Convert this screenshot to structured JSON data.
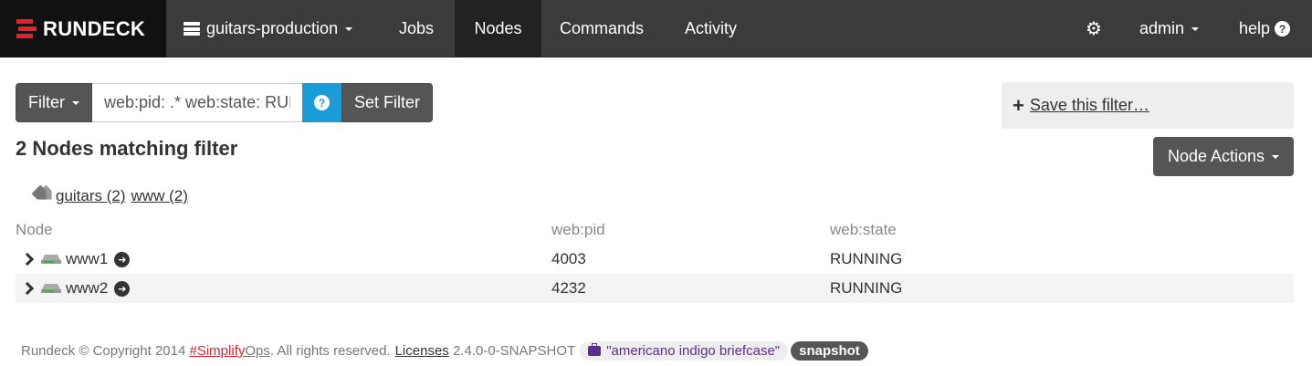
{
  "navbar": {
    "brand": "RUNDECK",
    "project": "guitars-production",
    "items": [
      {
        "label": "Jobs"
      },
      {
        "label": "Nodes"
      },
      {
        "label": "Commands"
      },
      {
        "label": "Activity"
      }
    ],
    "user": "admin",
    "help": "help",
    "active": "Nodes"
  },
  "filter": {
    "button_label": "Filter",
    "input_value": "web:pid: .* web:state: RUNNING",
    "help_icon": "?",
    "set_label": "Set Filter",
    "save_label": "Save this filter…"
  },
  "results": {
    "heading": "2 Nodes matching filter",
    "actions_label": "Node Actions"
  },
  "tags": [
    {
      "label": "guitars (2)"
    },
    {
      "label": "www (2)"
    }
  ],
  "table": {
    "headers": [
      "Node",
      "web:pid",
      "web:state"
    ],
    "rows": [
      {
        "node": "www1",
        "pid": "4003",
        "state": "RUNNING"
      },
      {
        "node": "www2",
        "pid": "4232",
        "state": "RUNNING"
      }
    ]
  },
  "footer": {
    "copyright": "Rundeck © Copyright 2014",
    "hash_prefix": "#Simplify",
    "hash_suffix": "Ops",
    "rights": ". All rights reserved.",
    "licenses": "Licenses",
    "version": "2.4.0-0-SNAPSHOT",
    "codename": "\"americano indigo briefcase\"",
    "badge": "snapshot"
  },
  "colors": {
    "navbar_bg": "#3b3b3b",
    "brand_bg": "#111111",
    "active_bg": "#222222",
    "brand_red": "#e8202a",
    "help_blue": "#1a9cd8",
    "button_gray": "#555555",
    "codename_purple": "#5b2d8e",
    "status_led": "#3cb44b"
  },
  "icons": {
    "brand": "rundeck-logo-icon",
    "project": "server-stack-icon",
    "settings": "gear-icon",
    "help": "question-circle-icon",
    "save": "plus-icon",
    "tags": "tags-icon",
    "expand": "chevron-right-icon",
    "node": "server-icon",
    "go": "arrow-circle-right-icon",
    "codename": "briefcase-icon"
  }
}
